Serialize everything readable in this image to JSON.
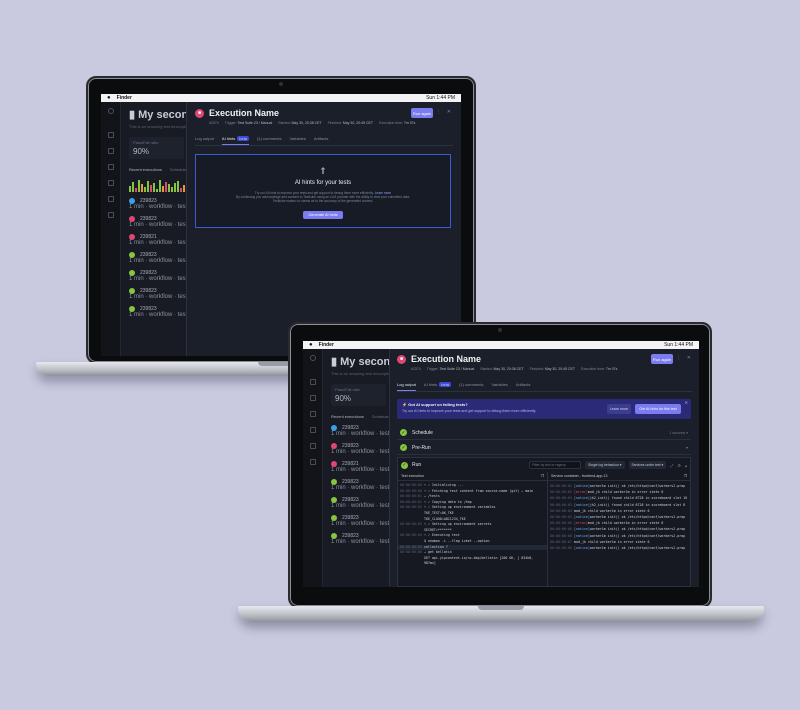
{
  "menubar": {
    "app": "Finder",
    "time": "Sun 1:44 PM"
  },
  "background": {
    "title": "My secon",
    "subtitle": "This is an amazing test description",
    "card": {
      "label": "Pass/Fail ratio",
      "value": "90%"
    },
    "tabs": [
      "Recent executions",
      "Schedule"
    ],
    "rows": [
      {
        "id": "239823",
        "status": "queued",
        "meta": "1 min · workflow · test"
      },
      {
        "id": "239823",
        "status": "failed",
        "meta": "1 min · workflow · test"
      },
      {
        "id": "239821",
        "status": "failed",
        "meta": "1 min · workflow · test"
      },
      {
        "id": "239823",
        "status": "passed",
        "meta": "1 min · workflow · test"
      },
      {
        "id": "239823",
        "status": "passed",
        "meta": "1 min · workflow · test"
      },
      {
        "id": "239823",
        "status": "passed",
        "meta": "1 min · workflow · test"
      },
      {
        "id": "239823",
        "status": "passed",
        "meta": "1 min · workflow · test"
      }
    ]
  },
  "execution": {
    "title": "Execution Name",
    "id": "#2374",
    "trigger_label": "Trigger:",
    "trigger": "Test Suite 23 / Manual",
    "started_label": "Started:",
    "started": "May 30, 20:38 CET",
    "finished_label": "Finished:",
    "finished": "May 30, 20:45 CET",
    "exec_label": "Execution time:",
    "exec_time": "7m 07s",
    "run_again": "Run again",
    "tabs": {
      "log": "Log output",
      "ai": "AI hints",
      "beta": "beta",
      "comments": "(1) comments",
      "variables": "Variables",
      "artifacts": "Artifacts"
    }
  },
  "ai_hints": {
    "title": "AI hints for your tests",
    "text1": "Try our AI hints to improve your tests and get support to debug them more efficiently.",
    "learn": "Learn more",
    "text2": "By continuing you acknowledge and consent to Testkube using an LLM provider with the ability to view your submitted data.",
    "text3": "Testkube makes no claims as to the accuracy of the generated content.",
    "button": "Generate AI hints"
  },
  "banner": {
    "title": "Got AI support on failing tests?",
    "text": "Try our AI hints to improve your tests and get support to debug them more efficiently.",
    "learn": "Learn more",
    "get": "Get AI hints for this test"
  },
  "stages": [
    {
      "name": "Schedule",
      "right": "1 seconds"
    },
    {
      "name": "Pre-Run",
      "right": ""
    },
    {
      "name": "Run",
      "right": ""
    }
  ],
  "run": {
    "filter_placeholder": "Filter by text or regexp",
    "dd1": "Single log behaviour",
    "dd2": "Services under test",
    "test_exec": "Test execution",
    "services": "Service container - frontend-app-13",
    "left_logs": [
      {
        "ts": "00:00:00:00",
        "text": "⚡ ✓ Initializing ...",
        "hl": false
      },
      {
        "ts": "00:00:00:00",
        "text": "⚡ ✓ Fetching test content from source-name (git) → main",
        "hl": false
      },
      {
        "ts": "00:00:00:01",
        "text": "  → /tests",
        "hl": false
      },
      {
        "ts": "00:00:00:01",
        "text": "⚡ ✓ Copying data to /tmp",
        "hl": false
      },
      {
        "ts": "00:00:00:02",
        "text": "⚡ ✓ Setting up environment variables",
        "hl": false
      },
      {
        "ts": "",
        "text": "    TKE_TEST=OK_TKE",
        "hl": false
      },
      {
        "ts": "",
        "text": "    TKE_CLOUD=ABC1234_TKE",
        "hl": false
      },
      {
        "ts": "00:00:00:03",
        "text": "⚡ ✓ Setting up environment secrets",
        "hl": false
      },
      {
        "ts": "",
        "text": "    SECRET=*******",
        "hl": false
      },
      {
        "ts": "00:00:00:04",
        "text": "⚡ ✓ Executing test",
        "hl": false
      },
      {
        "ts": "",
        "text": "    $ newman -i --flag icket --option",
        "hl": false
      },
      {
        "ts": "00:00:00:05",
        "text": "  collection ?",
        "hl": true
      },
      {
        "ts": "00:00:00:06",
        "text": "  → get bellatin",
        "hl": false
      },
      {
        "ts": "",
        "text": "    GET api.yipcontent.io/ns-bbp/bellatin [200 OK, ] 834kB,",
        "hl": false
      },
      {
        "ts": "",
        "text": "    987ms]",
        "hl": false
      }
    ],
    "right_logs": [
      {
        "ts": "00:00:00:01",
        "tag": "[notice]",
        "tagtype": "notice",
        "text": " worker1m init() ok /etc/httpd/conf/workers2.prop"
      },
      {
        "ts": "00:00:00:02",
        "tag": "[error]",
        "tagtype": "error",
        "text": " mod_jk child worker1m in error state 6"
      },
      {
        "ts": "00:00:00:03",
        "tag": "[notice]",
        "tagtype": "notice",
        "text": " jk2_init() found child 6728 in scoreboard slot 10"
      },
      {
        "ts": "00:00:00:03",
        "tag": "[notice]",
        "tagtype": "notice",
        "text": " jk2_init() found child 6728 in scoreboard slot 8"
      },
      {
        "ts": "00:00:00:04",
        "tag": "",
        "tagtype": "",
        "text": "mod_jk child worker1m in error state 6"
      },
      {
        "ts": "00:00:00:05",
        "tag": "[notice]",
        "tagtype": "notice",
        "text": " worker1m init() ok /etc/httpd/conf/workers2.prop"
      },
      {
        "ts": "00:00:00:05",
        "tag": "[error]",
        "tagtype": "error",
        "text": " mod_jk child worker1m in error state 6"
      },
      {
        "ts": "00:00:00:06",
        "tag": "[notice]",
        "tagtype": "notice",
        "text": " worker1m init() ok /etc/httpd/conf/workers2.prop"
      },
      {
        "ts": "00:00:00:06",
        "tag": "[notice]",
        "tagtype": "notice",
        "text": " worker1m init() ok /etc/httpd/conf/workers2.prop"
      },
      {
        "ts": "00:00:00:07",
        "tag": "",
        "tagtype": "",
        "text": "mod_jk child worker1m in error state 6"
      },
      {
        "ts": "00:00:00:08",
        "tag": "[notice]",
        "tagtype": "notice",
        "text": " worker1m init() ok /etc/httpd/conf/workers2.prop"
      }
    ]
  },
  "colors": {
    "background": "#c9cadf",
    "accent": "#7a7cf0",
    "failed": "#e04674",
    "passed": "#87c43f",
    "panel": "#1b1f29"
  }
}
